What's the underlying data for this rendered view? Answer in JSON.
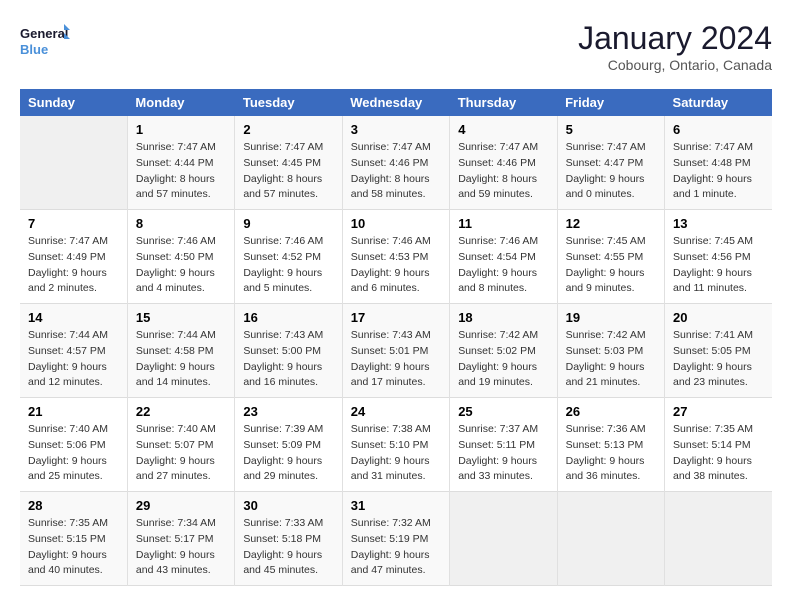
{
  "logo": {
    "line1": "General",
    "line2": "Blue"
  },
  "title": "January 2024",
  "location": "Cobourg, Ontario, Canada",
  "days_of_week": [
    "Sunday",
    "Monday",
    "Tuesday",
    "Wednesday",
    "Thursday",
    "Friday",
    "Saturday"
  ],
  "weeks": [
    [
      {
        "num": "",
        "sunrise": "",
        "sunset": "",
        "daylight": ""
      },
      {
        "num": "1",
        "sunrise": "Sunrise: 7:47 AM",
        "sunset": "Sunset: 4:44 PM",
        "daylight": "Daylight: 8 hours and 57 minutes."
      },
      {
        "num": "2",
        "sunrise": "Sunrise: 7:47 AM",
        "sunset": "Sunset: 4:45 PM",
        "daylight": "Daylight: 8 hours and 57 minutes."
      },
      {
        "num": "3",
        "sunrise": "Sunrise: 7:47 AM",
        "sunset": "Sunset: 4:46 PM",
        "daylight": "Daylight: 8 hours and 58 minutes."
      },
      {
        "num": "4",
        "sunrise": "Sunrise: 7:47 AM",
        "sunset": "Sunset: 4:46 PM",
        "daylight": "Daylight: 8 hours and 59 minutes."
      },
      {
        "num": "5",
        "sunrise": "Sunrise: 7:47 AM",
        "sunset": "Sunset: 4:47 PM",
        "daylight": "Daylight: 9 hours and 0 minutes."
      },
      {
        "num": "6",
        "sunrise": "Sunrise: 7:47 AM",
        "sunset": "Sunset: 4:48 PM",
        "daylight": "Daylight: 9 hours and 1 minute."
      }
    ],
    [
      {
        "num": "7",
        "sunrise": "Sunrise: 7:47 AM",
        "sunset": "Sunset: 4:49 PM",
        "daylight": "Daylight: 9 hours and 2 minutes."
      },
      {
        "num": "8",
        "sunrise": "Sunrise: 7:46 AM",
        "sunset": "Sunset: 4:50 PM",
        "daylight": "Daylight: 9 hours and 4 minutes."
      },
      {
        "num": "9",
        "sunrise": "Sunrise: 7:46 AM",
        "sunset": "Sunset: 4:52 PM",
        "daylight": "Daylight: 9 hours and 5 minutes."
      },
      {
        "num": "10",
        "sunrise": "Sunrise: 7:46 AM",
        "sunset": "Sunset: 4:53 PM",
        "daylight": "Daylight: 9 hours and 6 minutes."
      },
      {
        "num": "11",
        "sunrise": "Sunrise: 7:46 AM",
        "sunset": "Sunset: 4:54 PM",
        "daylight": "Daylight: 9 hours and 8 minutes."
      },
      {
        "num": "12",
        "sunrise": "Sunrise: 7:45 AM",
        "sunset": "Sunset: 4:55 PM",
        "daylight": "Daylight: 9 hours and 9 minutes."
      },
      {
        "num": "13",
        "sunrise": "Sunrise: 7:45 AM",
        "sunset": "Sunset: 4:56 PM",
        "daylight": "Daylight: 9 hours and 11 minutes."
      }
    ],
    [
      {
        "num": "14",
        "sunrise": "Sunrise: 7:44 AM",
        "sunset": "Sunset: 4:57 PM",
        "daylight": "Daylight: 9 hours and 12 minutes."
      },
      {
        "num": "15",
        "sunrise": "Sunrise: 7:44 AM",
        "sunset": "Sunset: 4:58 PM",
        "daylight": "Daylight: 9 hours and 14 minutes."
      },
      {
        "num": "16",
        "sunrise": "Sunrise: 7:43 AM",
        "sunset": "Sunset: 5:00 PM",
        "daylight": "Daylight: 9 hours and 16 minutes."
      },
      {
        "num": "17",
        "sunrise": "Sunrise: 7:43 AM",
        "sunset": "Sunset: 5:01 PM",
        "daylight": "Daylight: 9 hours and 17 minutes."
      },
      {
        "num": "18",
        "sunrise": "Sunrise: 7:42 AM",
        "sunset": "Sunset: 5:02 PM",
        "daylight": "Daylight: 9 hours and 19 minutes."
      },
      {
        "num": "19",
        "sunrise": "Sunrise: 7:42 AM",
        "sunset": "Sunset: 5:03 PM",
        "daylight": "Daylight: 9 hours and 21 minutes."
      },
      {
        "num": "20",
        "sunrise": "Sunrise: 7:41 AM",
        "sunset": "Sunset: 5:05 PM",
        "daylight": "Daylight: 9 hours and 23 minutes."
      }
    ],
    [
      {
        "num": "21",
        "sunrise": "Sunrise: 7:40 AM",
        "sunset": "Sunset: 5:06 PM",
        "daylight": "Daylight: 9 hours and 25 minutes."
      },
      {
        "num": "22",
        "sunrise": "Sunrise: 7:40 AM",
        "sunset": "Sunset: 5:07 PM",
        "daylight": "Daylight: 9 hours and 27 minutes."
      },
      {
        "num": "23",
        "sunrise": "Sunrise: 7:39 AM",
        "sunset": "Sunset: 5:09 PM",
        "daylight": "Daylight: 9 hours and 29 minutes."
      },
      {
        "num": "24",
        "sunrise": "Sunrise: 7:38 AM",
        "sunset": "Sunset: 5:10 PM",
        "daylight": "Daylight: 9 hours and 31 minutes."
      },
      {
        "num": "25",
        "sunrise": "Sunrise: 7:37 AM",
        "sunset": "Sunset: 5:11 PM",
        "daylight": "Daylight: 9 hours and 33 minutes."
      },
      {
        "num": "26",
        "sunrise": "Sunrise: 7:36 AM",
        "sunset": "Sunset: 5:13 PM",
        "daylight": "Daylight: 9 hours and 36 minutes."
      },
      {
        "num": "27",
        "sunrise": "Sunrise: 7:35 AM",
        "sunset": "Sunset: 5:14 PM",
        "daylight": "Daylight: 9 hours and 38 minutes."
      }
    ],
    [
      {
        "num": "28",
        "sunrise": "Sunrise: 7:35 AM",
        "sunset": "Sunset: 5:15 PM",
        "daylight": "Daylight: 9 hours and 40 minutes."
      },
      {
        "num": "29",
        "sunrise": "Sunrise: 7:34 AM",
        "sunset": "Sunset: 5:17 PM",
        "daylight": "Daylight: 9 hours and 43 minutes."
      },
      {
        "num": "30",
        "sunrise": "Sunrise: 7:33 AM",
        "sunset": "Sunset: 5:18 PM",
        "daylight": "Daylight: 9 hours and 45 minutes."
      },
      {
        "num": "31",
        "sunrise": "Sunrise: 7:32 AM",
        "sunset": "Sunset: 5:19 PM",
        "daylight": "Daylight: 9 hours and 47 minutes."
      },
      {
        "num": "",
        "sunrise": "",
        "sunset": "",
        "daylight": ""
      },
      {
        "num": "",
        "sunrise": "",
        "sunset": "",
        "daylight": ""
      },
      {
        "num": "",
        "sunrise": "",
        "sunset": "",
        "daylight": ""
      }
    ]
  ]
}
